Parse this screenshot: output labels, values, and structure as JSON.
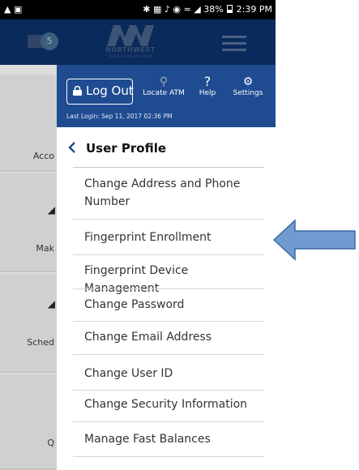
{
  "status_bar": {
    "right_text": "38%",
    "time": "2:39 PM"
  },
  "app_header": {
    "mail_count": "5",
    "logo_name": "NORTHWEST",
    "logo_sub": "FEDERAL CREDIT UNION"
  },
  "background": {
    "labels": [
      "Acco",
      "Mak",
      "Sched",
      "Q"
    ]
  },
  "drawer": {
    "logout_label": "Log Out",
    "actions": {
      "locate_atm": "Locate ATM",
      "help": "Help",
      "settings": "Settings"
    },
    "last_login": "Last Login: Sep 11, 2017 02:36 PM",
    "section_title": "User Profile",
    "items": [
      "Change Address and Phone Number",
      "Fingerprint Enrollment",
      "Fingerprint Device Management",
      "Change Password",
      "Change Email Address",
      "Change User ID",
      "Change Security Information",
      "Manage Fast Balances"
    ]
  },
  "colors": {
    "drawer_header": "#1f4b91",
    "app_header": "#0a2a5c",
    "chevron": "#1f4b91",
    "arrow_fill": "#6f9bd1",
    "arrow_stroke": "#3e6aa3"
  }
}
